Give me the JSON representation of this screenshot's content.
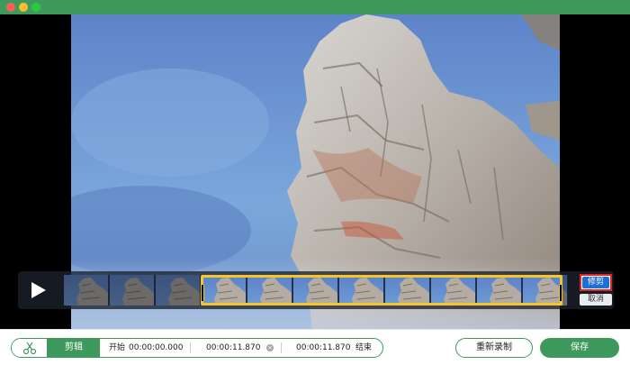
{
  "window": {
    "accent": "#3e9a5c"
  },
  "trim": {
    "trim_label": "修剪",
    "cancel_label": "取消",
    "selection_color": "#f6c42b",
    "trim_button_color": "#1f6fd1",
    "thumbnails": 11
  },
  "editor": {
    "clip_label": "剪辑",
    "start_label": "开始",
    "start_time": "00:00:00.000",
    "duration": "00:00:11.870",
    "end_time": "00:00:11.870",
    "end_label": "结束"
  },
  "actions": {
    "rerecord_label": "重新录制",
    "save_label": "保存"
  }
}
